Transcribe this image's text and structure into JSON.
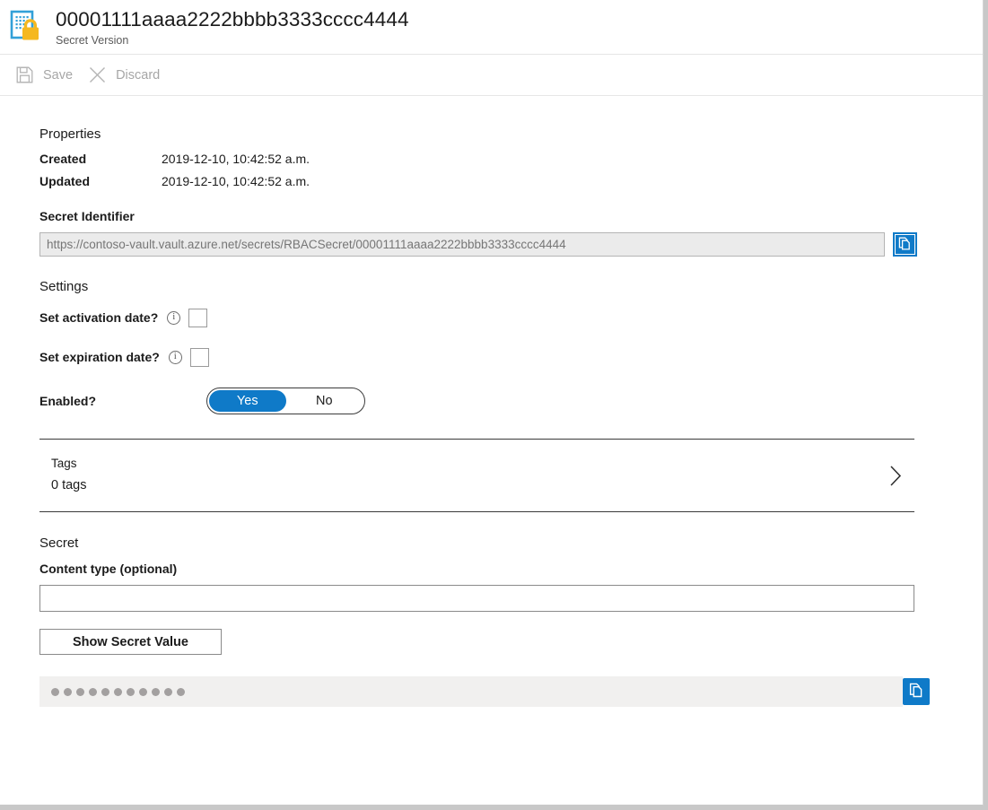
{
  "header": {
    "icon": "secret-key-document-icon",
    "title": "00001111aaaa2222bbbb3333cccc4444",
    "subtitle": "Secret Version"
  },
  "commandbar": {
    "save": {
      "label": "Save",
      "icon": "save-floppy-icon",
      "disabled": true
    },
    "discard": {
      "label": "Discard",
      "icon": "close-x-icon",
      "disabled": true
    }
  },
  "properties": {
    "heading": "Properties",
    "rows": [
      {
        "label": "Created",
        "value": "2019-12-10, 10:42:52 a.m."
      },
      {
        "label": "Updated",
        "value": "2019-12-10, 10:42:52 a.m."
      }
    ]
  },
  "secret_identifier": {
    "label": "Secret Identifier",
    "value": "https://contoso-vault.vault.azure.net/secrets/RBACSecret/00001111aaaa2222bbbb3333cccc4444",
    "copy_icon": "copy-icon"
  },
  "settings": {
    "heading": "Settings",
    "activation": {
      "label": "Set activation date?",
      "info_icon": "info-icon",
      "checked": false
    },
    "expiration": {
      "label": "Set expiration date?",
      "info_icon": "info-icon",
      "checked": false
    },
    "enabled": {
      "label": "Enabled?",
      "options": [
        "Yes",
        "No"
      ],
      "selected": "Yes"
    }
  },
  "tags": {
    "title": "Tags",
    "count_label": "0 tags",
    "chevron_icon": "chevron-right-icon"
  },
  "secret": {
    "heading": "Secret",
    "content_type_label": "Content type (optional)",
    "content_type_value": "",
    "content_type_placeholder": "",
    "show_button_label": "Show Secret Value",
    "masked_value_dots": 11,
    "copy_icon": "copy-icon"
  },
  "colors": {
    "accent_blue": "#0f7ac8",
    "icon_yellow": "#f5b820",
    "icon_blue": "#32a0d8",
    "disabled_text": "#a6a6a6",
    "readonly_bg": "#ebebeb",
    "masked_bg": "#f1f0ef"
  }
}
